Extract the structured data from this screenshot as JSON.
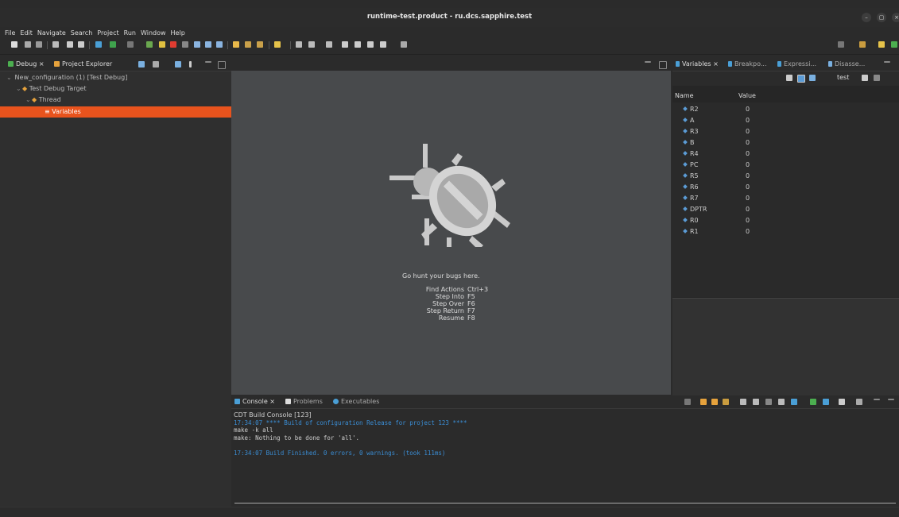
{
  "window": {
    "title": "runtime-test.product - ru.dcs.sapphire.test"
  },
  "menu": [
    "File",
    "Edit",
    "Navigate",
    "Search",
    "Project",
    "Run",
    "Window",
    "Help"
  ],
  "debug_view": {
    "tabs": [
      "Debug",
      "Project Explorer"
    ],
    "tree": [
      {
        "label": "New_configuration (1) [Test Debug]",
        "level": 0,
        "expanded": true
      },
      {
        "label": "Test Debug Target",
        "level": 1,
        "expanded": true
      },
      {
        "label": "Thread",
        "level": 2,
        "expanded": true
      },
      {
        "label": "Variables",
        "level": 3,
        "selected": true
      }
    ]
  },
  "editor": {
    "empty_title": "Go hunt your bugs here.",
    "hints": [
      {
        "action": "Find Actions",
        "key": "Ctrl+3"
      },
      {
        "action": "Step Into",
        "key": "F5"
      },
      {
        "action": "Step Over",
        "key": "F6"
      },
      {
        "action": "Step Return",
        "key": "F7"
      },
      {
        "action": "Resume",
        "key": "F8"
      }
    ]
  },
  "variables_view": {
    "tabs": [
      "Variables",
      "Breakpo...",
      "Expressi...",
      "Disasse..."
    ],
    "toolbar_label": "test",
    "columns": [
      "Name",
      "Value"
    ],
    "rows": [
      {
        "name": "R2",
        "value": "0"
      },
      {
        "name": "A",
        "value": "0"
      },
      {
        "name": "R3",
        "value": "0"
      },
      {
        "name": "B",
        "value": "0"
      },
      {
        "name": "R4",
        "value": "0"
      },
      {
        "name": "PC",
        "value": "0"
      },
      {
        "name": "R5",
        "value": "0"
      },
      {
        "name": "R6",
        "value": "0"
      },
      {
        "name": "R7",
        "value": "0"
      },
      {
        "name": "DPTR",
        "value": "0"
      },
      {
        "name": "R0",
        "value": "0"
      },
      {
        "name": "R1",
        "value": "0"
      }
    ]
  },
  "console": {
    "tabs": [
      "Console",
      "Problems",
      "Executables"
    ],
    "header": "CDT Build Console [123]",
    "lines": [
      {
        "text": "17:34:07 **** Build of configuration Release for project 123 ****",
        "color": "blue"
      },
      {
        "text": "make -k all",
        "color": "normal"
      },
      {
        "text": "make: Nothing to be done for 'all'.",
        "color": "normal"
      },
      {
        "text": "",
        "color": "normal"
      },
      {
        "text": "17:34:07 Build Finished. 0 errors, 0 warnings. (took 111ms)",
        "color": "blue"
      }
    ]
  },
  "colors": {
    "selection": "#e8531d",
    "console_blue": "#3a8dd4",
    "editor_bg": "#484a4c"
  }
}
